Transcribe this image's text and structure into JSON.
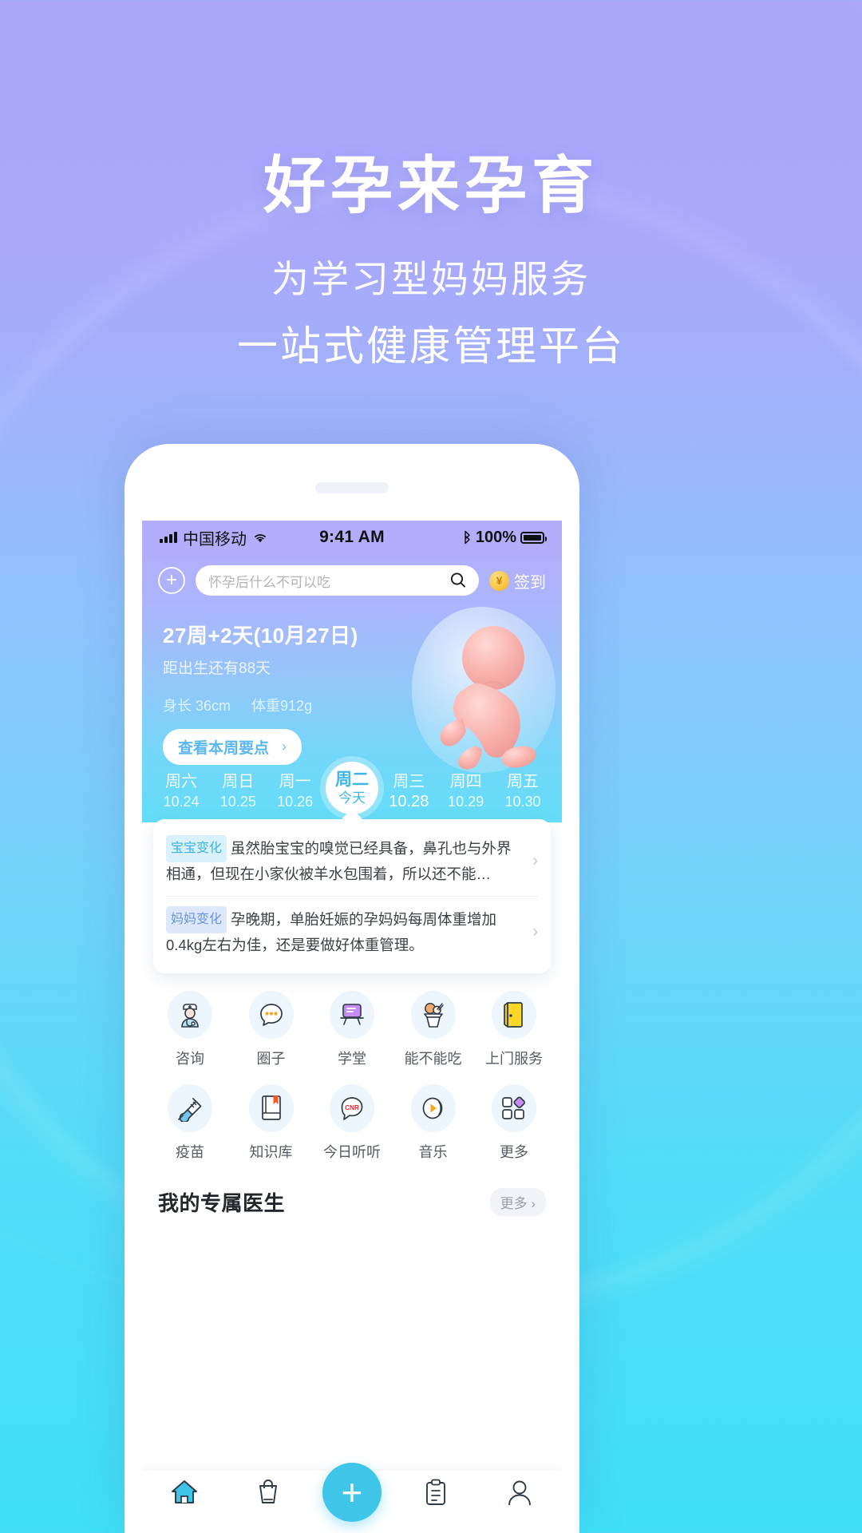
{
  "hero": {
    "title": "好孕来孕育",
    "subtitle1": "为学习型妈妈服务",
    "subtitle2": "一站式健康管理平台"
  },
  "statusbar": {
    "carrier": "中国移动",
    "time": "9:41 AM",
    "battery": "100%",
    "signal_icon": "signal-bars-icon",
    "wifi_icon": "wifi-icon",
    "bluetooth_icon": "bluetooth-icon",
    "battery_icon": "battery-icon"
  },
  "search": {
    "add_icon": "plus-circle-icon",
    "placeholder": "怀孕后什么不可以吃",
    "search_icon": "search-icon",
    "coin_symbol": "¥",
    "signin_label": "签到"
  },
  "pregnancy": {
    "week_title": "27周+2天(10月27日)",
    "due_text": "距出生还有88天",
    "length_label": "身长 36cm",
    "weight_label": "体重912g",
    "week_button": "查看本周要点",
    "week_button_chevron": "›",
    "fetus_icon": "fetus-illustration"
  },
  "week_strip": {
    "days": [
      {
        "name": "周六",
        "date": "10.24",
        "today": false
      },
      {
        "name": "周日",
        "date": "10.25",
        "today": false
      },
      {
        "name": "周一",
        "date": "10.26",
        "today": false
      },
      {
        "name": "周二",
        "date": "今天",
        "today": true
      },
      {
        "name": "周三",
        "date": "10.28",
        "today": false
      },
      {
        "name": "周四",
        "date": "10.29",
        "today": false
      },
      {
        "name": "周五",
        "date": "10.30",
        "today": false
      }
    ]
  },
  "cards": [
    {
      "tag": "宝宝变化",
      "text": "虽然胎宝宝的嗅觉已经具备，鼻孔也与外界相通，但现在小家伙被羊水包围着，所以还不能…",
      "chevron": "›"
    },
    {
      "tag": "妈妈变化",
      "text": "孕晚期，单胎妊娠的孕妈妈每周体重增加0.4kg左右为佳，还是要做好体重管理。",
      "chevron": "›"
    }
  ],
  "grid": {
    "row1": [
      {
        "label": "咨询",
        "icon": "doctor-icon"
      },
      {
        "label": "圈子",
        "icon": "chat-bubble-icon"
      },
      {
        "label": "学堂",
        "icon": "whiteboard-icon"
      },
      {
        "label": "能不能吃",
        "icon": "icecream-icon"
      },
      {
        "label": "上门服务",
        "icon": "door-icon"
      }
    ],
    "row2": [
      {
        "label": "疫苗",
        "icon": "syringe-icon"
      },
      {
        "label": "知识库",
        "icon": "book-icon"
      },
      {
        "label": "今日听听",
        "icon": "cnr-radio-icon"
      },
      {
        "label": "音乐",
        "icon": "music-play-icon"
      },
      {
        "label": "更多",
        "icon": "grid-more-icon"
      }
    ]
  },
  "doctor_section": {
    "title": "我的专属医生",
    "more_label": "更多 ›"
  },
  "tabbar": {
    "items": [
      {
        "icon": "home-icon",
        "active": true
      },
      {
        "icon": "shop-bag-icon",
        "active": false
      },
      {
        "icon": "plus-fab-icon",
        "active": false
      },
      {
        "icon": "record-clipboard-icon",
        "active": false
      },
      {
        "icon": "profile-person-icon",
        "active": false
      }
    ],
    "fab_symbol": "+"
  },
  "colors": {
    "bg_top": "#aaa6fa",
    "bg_bottom": "#3fe0f6",
    "accent_cyan": "#3fc5e8",
    "tag_baby_bg": "#d9f1fb",
    "tag_mom_bg": "#dde8fb"
  }
}
